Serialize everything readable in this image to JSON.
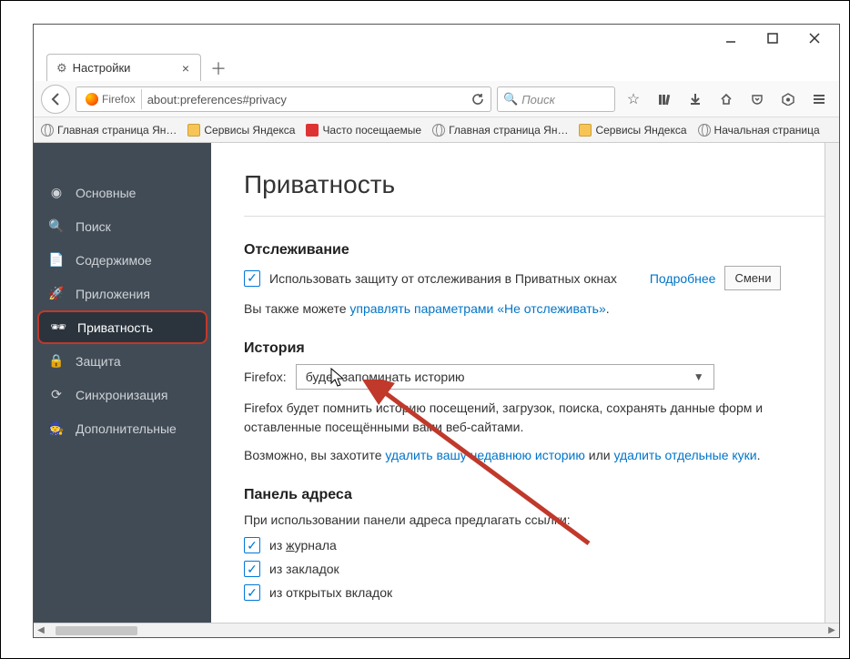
{
  "window": {
    "tab_title": "Настройки"
  },
  "urlbar": {
    "identity": "Firefox",
    "url": "about:preferences#privacy"
  },
  "search": {
    "placeholder": "Поиск"
  },
  "bookmarks": [
    {
      "label": "Главная страница Ян…",
      "icon": "globe"
    },
    {
      "label": "Сервисы Яндекса",
      "icon": "folder"
    },
    {
      "label": "Часто посещаемые",
      "icon": "ya"
    },
    {
      "label": "Главная страница Ян…",
      "icon": "globe"
    },
    {
      "label": "Сервисы Яндекса",
      "icon": "folder"
    },
    {
      "label": "Начальная страница",
      "icon": "globe"
    }
  ],
  "sidebar": {
    "items": [
      {
        "label": "Основные"
      },
      {
        "label": "Поиск"
      },
      {
        "label": "Содержимое"
      },
      {
        "label": "Приложения"
      },
      {
        "label": "Приватность"
      },
      {
        "label": "Защита"
      },
      {
        "label": "Синхронизация"
      },
      {
        "label": "Дополнительные"
      }
    ]
  },
  "main": {
    "title": "Приватность",
    "tracking": {
      "heading": "Отслеживание",
      "checkbox_label": "Использовать защиту от отслеживания в Приватных окнах",
      "more": "Подробнее",
      "change": "Смени",
      "also_prefix": "Вы также можете ",
      "also_link": "управлять параметрами «Не отслеживать»",
      "also_suffix": "."
    },
    "history": {
      "heading": "История",
      "firefox_label": "Firefox:",
      "select_value": "будет запоминать историю",
      "desc": "Firefox будет помнить историю посещений, загрузок, поиска, сохранять данные форм и оставленные посещёнными вами веб-сайтами.",
      "maybe_prefix": "Возможно, вы захотите ",
      "maybe_link1": "удалить вашу недавнюю историю",
      "maybe_mid": " или ",
      "maybe_link2": "удалить отдельные куки",
      "maybe_suffix": "."
    },
    "addressbar": {
      "heading": "Панель адреса",
      "intro": "При использовании панели адреса предлагать ссылки:",
      "opt1_pre": "из ",
      "opt1_u": "ж",
      "opt1_post": "урнала",
      "opt2": "из закладок",
      "opt3": "из открытых вкладок"
    }
  }
}
